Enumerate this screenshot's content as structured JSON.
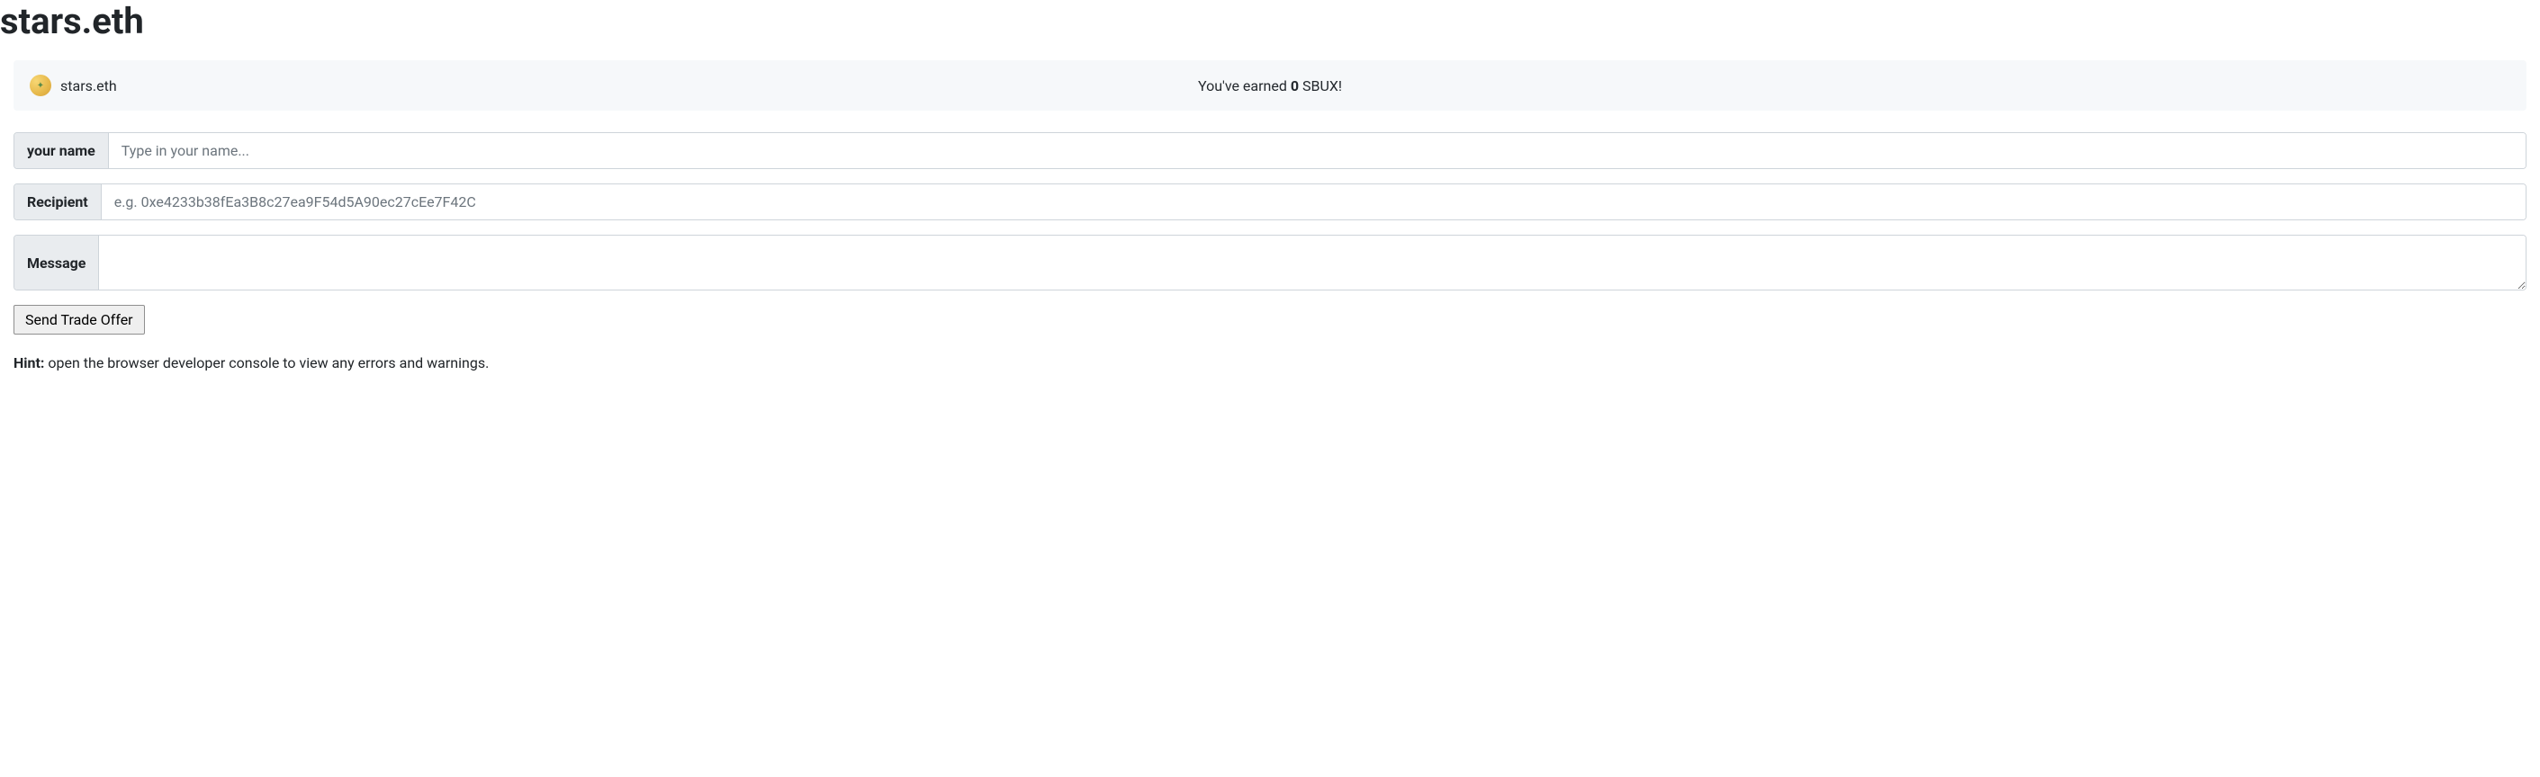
{
  "title": "stars.eth",
  "status": {
    "wallet_name": "stars.eth",
    "earned_prefix": "You've earned ",
    "earned_amount": "0",
    "earned_suffix": " SBUX!"
  },
  "form": {
    "name_label": "your name",
    "name_placeholder": "Type in your name...",
    "recipient_label": "Recipient",
    "recipient_placeholder": "e.g. 0xe4233b38fEa3B8c27ea9F54d5A90ec27cEe7F42C",
    "message_label": "Message",
    "submit_label": "Send Trade Offer"
  },
  "hint": {
    "label": "Hint:",
    "text": " open the browser developer console to view any errors and warnings."
  }
}
